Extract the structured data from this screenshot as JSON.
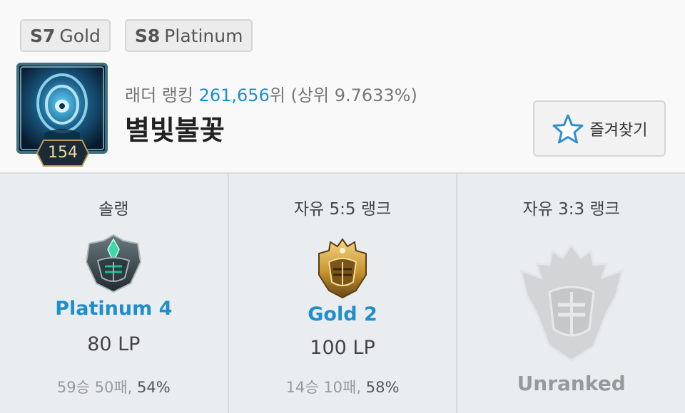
{
  "past_seasons": [
    {
      "season": "S7",
      "tier": "Gold"
    },
    {
      "season": "S8",
      "tier": "Platinum"
    }
  ],
  "profile": {
    "level": "154",
    "ladder_prefix": "래더 랭킹",
    "ladder_rank": "261,656",
    "ladder_suffix": "위 (상위 9.7633%)",
    "summoner_name": "별빛불꽃"
  },
  "favorite_button": {
    "label": "즐겨찾기",
    "icon": "star-icon"
  },
  "queues": [
    {
      "queue": "솔랭",
      "emblem": "platinum-emblem",
      "tier": "Platinum 4",
      "lp": "80 LP",
      "record": "59승 50패,",
      "winrate": "54%"
    },
    {
      "queue": "자유 5:5 랭크",
      "emblem": "gold-emblem",
      "tier": "Gold 2",
      "lp": "100 LP",
      "record": "14승 10패,",
      "winrate": "58%"
    },
    {
      "queue": "자유 3:3 랭크",
      "emblem": "unranked-emblem",
      "tier": "Unranked"
    }
  ],
  "colors": {
    "accent": "#1f8ecd",
    "platinum": "#3fb59a",
    "gold": "#c8962e",
    "unranked": "#d3d4d6"
  }
}
